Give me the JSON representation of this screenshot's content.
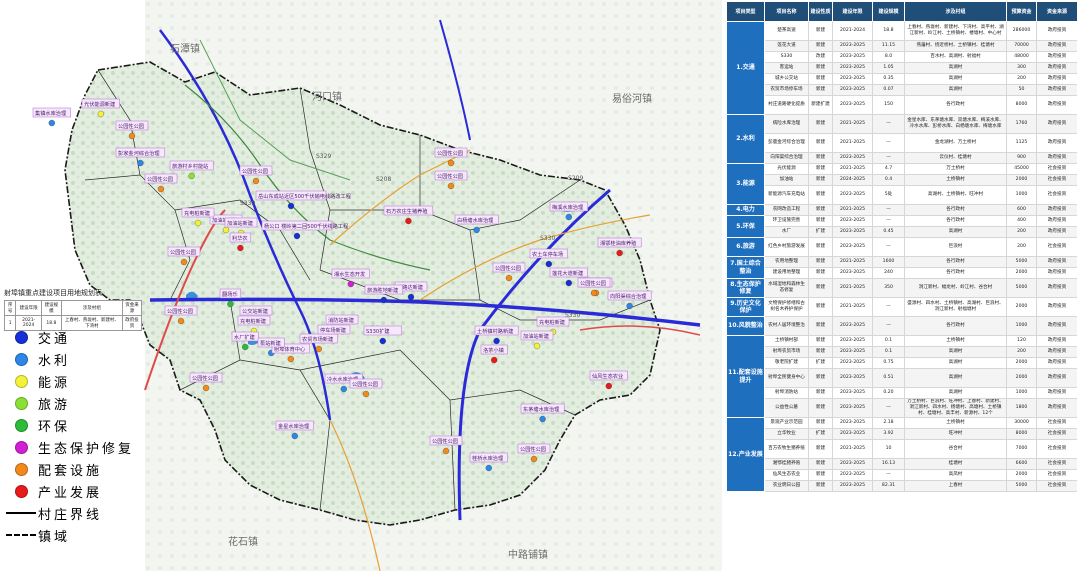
{
  "map": {
    "towns": [
      {
        "id": "shitan",
        "name": "石潭镇"
      },
      {
        "id": "hekou",
        "name": "河口镇"
      },
      {
        "id": "yijiahe",
        "name": "易俗河镇"
      },
      {
        "id": "huashi",
        "name": "花石镇"
      },
      {
        "id": "zhongluopu",
        "name": "中路铺镇"
      }
    ],
    "projects": [
      "光伏能源新建",
      "集镇水库治理",
      "公园性公园",
      "彭家金河综合治理",
      "旅游村乡村能站",
      "公园性公园",
      "公园性公园",
      "公园性公园",
      "岳山东成站近区500千伏输电线路改工程",
      "加油站新建",
      "杨公口 楼岭第二回500千伏线路工程",
      "充电桩新建",
      "加油站新建",
      "利华农",
      "公园性公园",
      "公园性公园",
      "石方农庄生猪养殖",
      "白杨塘水库治理",
      "梅溪水库治理",
      "湘鄂桂油库养殖",
      "农土车停车场",
      "公园性公园",
      "公园性公园",
      "道路达新建",
      "莲花大道新建",
      "公园性公园",
      "向阳渠综合治理",
      "湘水生态开发",
      "翻场乐",
      "公园性公园",
      "旅游胜地新建",
      "S330扩建",
      "农贸市场新建",
      "水厂扩建",
      "充电桩新建",
      "停车场新建",
      "消防站新建",
      "射埠体育中心",
      "冷水水库治理",
      "公园性公园",
      "土桥镇村路新建",
      "充电桩新建",
      "加油站新建",
      "洛茶小镇",
      "仙风生态农业",
      "东茅塘水库治理",
      "金星水库治理",
      "公园性公园",
      "桂桥水库治理",
      "公园性公园",
      "公园性公园",
      "公交站新建",
      "泵站新建"
    ],
    "roads": [
      "S329",
      "S330",
      "S330",
      "S330",
      "S208",
      "S209",
      "G4"
    ],
    "mini_table": {
      "title": "射埠镇重点建设项目用地规划表",
      "headers": [
        "序号",
        "建设年限",
        "建设规模",
        "涉及村组",
        "资金来源"
      ],
      "row": [
        "1",
        "2021-2024",
        "18.8",
        "上春村、燕垅村、新建村、下湾村",
        "政府投资"
      ]
    }
  },
  "legend": [
    {
      "type": "dot",
      "color": "#1530d8",
      "label": "交通"
    },
    {
      "type": "dot",
      "color": "#2e86e8",
      "label": "水利"
    },
    {
      "type": "dot",
      "color": "#f2f23a",
      "label": "能源"
    },
    {
      "type": "dot",
      "color": "#8be035",
      "label": "旅游"
    },
    {
      "type": "dot",
      "color": "#2dbb3a",
      "label": "环保"
    },
    {
      "type": "dot",
      "color": "#d11fd4",
      "label": "生态保护修复"
    },
    {
      "type": "dot",
      "color": "#f28a1a",
      "label": "配套设施"
    },
    {
      "type": "dot",
      "color": "#e81a1a",
      "label": "产业发展"
    },
    {
      "type": "line",
      "label": "村庄界线"
    },
    {
      "type": "dashline",
      "label": "镇域"
    }
  ],
  "table": {
    "headers": [
      "项目类型",
      "项目名称",
      "建设性质",
      "建设年限",
      "建设规模",
      "涉及村组",
      "预算资金",
      "资金来源"
    ],
    "categories": [
      {
        "name": "1.交通",
        "rows": [
          [
            "楚茶高速",
            "新建",
            "2021-2024",
            "18.8",
            "上春村、燕垅村、新建村、下湾村、高平村、湖江新村、岭江村、土桥镇村、楼塘村、中心村",
            "286000",
            "政府投资"
          ],
          [
            "莲花大道",
            "新建",
            "2023-2025",
            "11.15",
            "燕藩村、绕近桥村、土桥镇村、桂塘村",
            "70000",
            "政府投资"
          ],
          [
            "S330",
            "改建",
            "2023-2025",
            "8.0",
            "百水村、高湖村、射福村",
            "48000",
            "政府投资"
          ],
          [
            "客运站",
            "新建",
            "2023-2025",
            "1.05",
            "高湖村",
            "300",
            "政府投资"
          ],
          [
            "城乡公交站",
            "新建",
            "2023-2025",
            "0.35",
            "高湖村",
            "200",
            "政府投资"
          ],
          [
            "农贸市场停车场",
            "新建",
            "2023-2025",
            "0.07",
            "高湖村",
            "50",
            "政府投资"
          ],
          [
            "村庄道路硬化提质",
            "新建扩建",
            "2023-2025",
            "150",
            "各行政村",
            "8000",
            "政府投资"
          ]
        ]
      },
      {
        "name": "2.水利",
        "rows": [
          [
            "病险水库治理",
            "新建",
            "2021-2025",
            "—",
            "金星水库、东茅塘水库、双塘水库、梅溪水库、冷水水库、彭桥水库、白杨塘水库、梅塘水库",
            "1760",
            "政府投资"
          ],
          [
            "彭鹿金河综合治理",
            "新建",
            "2021-2025",
            "—",
            "金龙湖村、万土桥村",
            "1125",
            "政府投资"
          ],
          [
            "向阳渠综合治理",
            "新建",
            "2023-2025",
            "—",
            "云仪村、桂塘村",
            "900",
            "政府投资"
          ]
        ]
      },
      {
        "name": "3.能源",
        "rows": [
          [
            "光伏能源",
            "新建",
            "2021-2025",
            "4.7",
            "万土桥村",
            "45000",
            "社会投资"
          ],
          [
            "加油站",
            "新建",
            "2024-2025",
            "0.4",
            "土桥镇村",
            "2000",
            "社会投资"
          ],
          [
            "新能源汽车充电站",
            "新建",
            "2023-2025",
            "5处",
            "高湖村、土桥镇村、旺冲村",
            "1000",
            "社会投资"
          ]
        ]
      },
      {
        "name": "4.电力",
        "rows": [
          [
            "农网改造工程",
            "新建",
            "2021-2025",
            "—",
            "各行政村",
            "600",
            "政府投资"
          ]
        ]
      },
      {
        "name": "5.环保",
        "rows": [
          [
            "环卫设施完善",
            "新建",
            "2023-2025",
            "—",
            "各行政村",
            "400",
            "政府投资"
          ],
          [
            "水厂",
            "扩建",
            "2023-2025",
            "0.45",
            "高湖村",
            "200",
            "政府投资"
          ]
        ]
      },
      {
        "name": "6.旅游",
        "rows": [
          [
            "红色乡村旅游发展",
            "新建",
            "2023-2025",
            "—",
            "巨浪村",
            "200",
            "社会投资"
          ]
        ]
      },
      {
        "name": "7.国土综合整治",
        "rows": [
          [
            "农用地整理",
            "新建",
            "2021-2025",
            "1600",
            "各行政村",
            "5000",
            "政府投资"
          ],
          [
            "建设用地整理",
            "新建",
            "2023-2025",
            "240",
            "各行政村",
            "2000",
            "政府投资"
          ]
        ]
      },
      {
        "name": "8.生态保护修复",
        "rows": [
          [
            "水域湿地和森林生态修复",
            "新建",
            "2021-2025",
            "350",
            "洞江新村、幅龙村、岭江村、谷合村",
            "5000",
            "政府投资"
          ]
        ]
      },
      {
        "name": "9.历史文化保护",
        "rows": [
          [
            "文物保护修缮和古树名木养护保护",
            "新建",
            "2021-2025",
            "—",
            "盛源村、四水村、土桥镇村、高湖村、巨浪村、洞江新村、射福塘村",
            "2000",
            "政府投资"
          ]
        ]
      },
      {
        "name": "10.风貌整治",
        "rows": [
          [
            "农村人居环境整治",
            "新建",
            "2023-2025",
            "—",
            "各行政村",
            "1000",
            "政府投资"
          ]
        ]
      },
      {
        "name": "11.配套设施提升",
        "rows": [
          [
            "土桥镇村部",
            "新建",
            "2023-2025",
            "0.1",
            "土桥镇村",
            "120",
            "政府投资"
          ],
          [
            "射埠农贸市场",
            "新建",
            "2023-2025",
            "0.1",
            "高湖村",
            "200",
            "政府投资"
          ],
          [
            "敬老院扩建",
            "扩建",
            "2023-2025",
            "0.75",
            "高湖村",
            "2000",
            "政府投资"
          ],
          [
            "射埠全民健身中心",
            "新建",
            "2023-2025",
            "0.51",
            "高湖村",
            "2000",
            "政府投资"
          ],
          [
            "射埠消防站",
            "新建",
            "2023-2025",
            "0.20",
            "高湖村",
            "1000",
            "政府投资"
          ],
          [
            "公益性公墓",
            "新建",
            "2023-2025",
            "—",
            "万土桥村、巨浪村、旺冲村、上春村、新建村、洞江新村、四水村、杨塘村、高塘村、土桥镇村、桂塘村、高丰村、新源村、12个",
            "1800",
            "政府投资"
          ]
        ]
      },
      {
        "name": "12.产业发展",
        "rows": [
          [
            "景观产业示范园",
            "新建",
            "2023-2025",
            "2.18",
            "土桥镇村",
            "30000",
            "社会投资"
          ],
          [
            "立华牧业",
            "扩建",
            "2023-2025",
            "3.92",
            "旺冲村",
            "8000",
            "社会投资"
          ],
          [
            "百方农牧生猪养殖",
            "新建",
            "2021-2025",
            "10",
            "谷合村",
            "7000",
            "社会投资"
          ],
          [
            "湘鄂桂猪养殖",
            "新建",
            "2023-2025",
            "16.13",
            "桂塘村",
            "6600",
            "社会投资"
          ],
          [
            "仙风生态农业",
            "新建",
            "2023-2025",
            "—",
            "高凤村",
            "2000",
            "社会投资"
          ],
          [
            "农业明日公园",
            "新建",
            "2023-2025",
            "82.31",
            "上春村",
            "5000",
            "社会投资"
          ]
        ]
      }
    ]
  }
}
